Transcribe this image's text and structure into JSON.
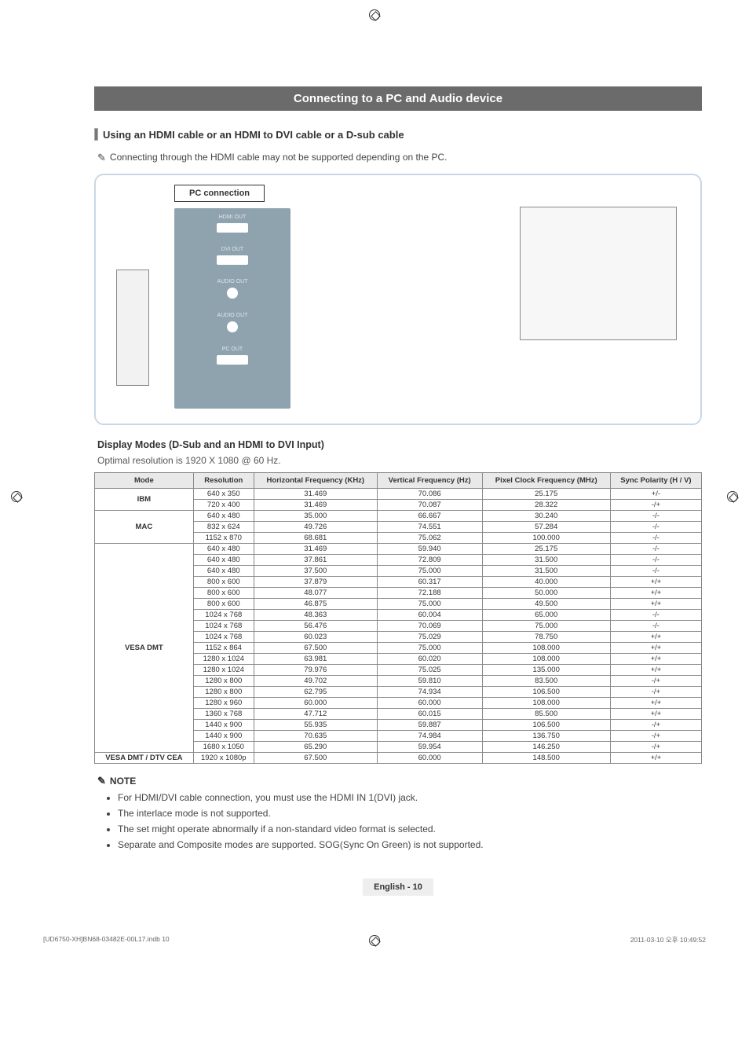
{
  "section_title": "Connecting to a PC and Audio device",
  "subhead": "Using an HDMI cable or an HDMI to DVI cable or a D-sub cable",
  "hint": "Connecting through the HDMI cable may not be supported depending on the PC.",
  "diagram": {
    "pc_connection": "PC connection",
    "ports": [
      "HDMI OUT",
      "DVI OUT",
      "AUDIO OUT",
      "AUDIO OUT",
      "PC OUT"
    ]
  },
  "display_modes_heading": "Display Modes (D-Sub and an HDMI to DVI Input)",
  "optimal_resolution": "Optimal resolution is 1920 X 1080 @ 60 Hz.",
  "table": {
    "headers": [
      "Mode",
      "Resolution",
      "Horizontal Frequency (KHz)",
      "Vertical Frequency (Hz)",
      "Pixel Clock Frequency (MHz)",
      "Sync Polarity (H / V)"
    ],
    "groups": [
      {
        "mode": "IBM",
        "rows": [
          [
            "640 x 350",
            "31.469",
            "70.086",
            "25.175",
            "+/-"
          ],
          [
            "720 x 400",
            "31.469",
            "70.087",
            "28.322",
            "-/+"
          ]
        ]
      },
      {
        "mode": "MAC",
        "rows": [
          [
            "640 x 480",
            "35.000",
            "66.667",
            "30.240",
            "-/-"
          ],
          [
            "832 x 624",
            "49.726",
            "74.551",
            "57.284",
            "-/-"
          ],
          [
            "1152 x 870",
            "68.681",
            "75.062",
            "100.000",
            "-/-"
          ]
        ]
      },
      {
        "mode": "VESA DMT",
        "rows": [
          [
            "640 x 480",
            "31.469",
            "59.940",
            "25.175",
            "-/-"
          ],
          [
            "640 x 480",
            "37.861",
            "72.809",
            "31.500",
            "-/-"
          ],
          [
            "640 x 480",
            "37.500",
            "75.000",
            "31.500",
            "-/-"
          ],
          [
            "800 x 600",
            "37.879",
            "60.317",
            "40.000",
            "+/+"
          ],
          [
            "800 x 600",
            "48.077",
            "72.188",
            "50.000",
            "+/+"
          ],
          [
            "800 x 600",
            "46.875",
            "75.000",
            "49.500",
            "+/+"
          ],
          [
            "1024 x 768",
            "48.363",
            "60.004",
            "65.000",
            "-/-"
          ],
          [
            "1024 x 768",
            "56.476",
            "70.069",
            "75.000",
            "-/-"
          ],
          [
            "1024 x 768",
            "60.023",
            "75.029",
            "78.750",
            "+/+"
          ],
          [
            "1152 x 864",
            "67.500",
            "75.000",
            "108.000",
            "+/+"
          ],
          [
            "1280 x 1024",
            "63.981",
            "60.020",
            "108.000",
            "+/+"
          ],
          [
            "1280 x 1024",
            "79.976",
            "75.025",
            "135.000",
            "+/+"
          ],
          [
            "1280 x 800",
            "49.702",
            "59.810",
            "83.500",
            "-/+"
          ],
          [
            "1280 x 800",
            "62.795",
            "74.934",
            "106.500",
            "-/+"
          ],
          [
            "1280 x 960",
            "60.000",
            "60.000",
            "108.000",
            "+/+"
          ],
          [
            "1360 x 768",
            "47.712",
            "60.015",
            "85.500",
            "+/+"
          ],
          [
            "1440 x 900",
            "55.935",
            "59.887",
            "106.500",
            "-/+"
          ],
          [
            "1440 x 900",
            "70.635",
            "74.984",
            "136.750",
            "-/+"
          ],
          [
            "1680 x 1050",
            "65.290",
            "59.954",
            "146.250",
            "-/+"
          ]
        ]
      },
      {
        "mode": "VESA DMT / DTV CEA",
        "rows": [
          [
            "1920 x 1080p",
            "67.500",
            "60.000",
            "148.500",
            "+/+"
          ]
        ]
      }
    ]
  },
  "note_label": "NOTE",
  "notes": [
    "For HDMI/DVI cable connection, you must use the HDMI IN 1(DVI) jack.",
    "The interlace mode is not supported.",
    "The set might operate abnormally if a non-standard video format is selected.",
    "Separate and Composite modes are supported. SOG(Sync On Green) is not supported."
  ],
  "footer_page": "English - 10",
  "bottom": {
    "left": "[UD6750-XH]BN68-03482E-00L17.indb   10",
    "right": "2011-03-10   오후 10:49:52"
  }
}
